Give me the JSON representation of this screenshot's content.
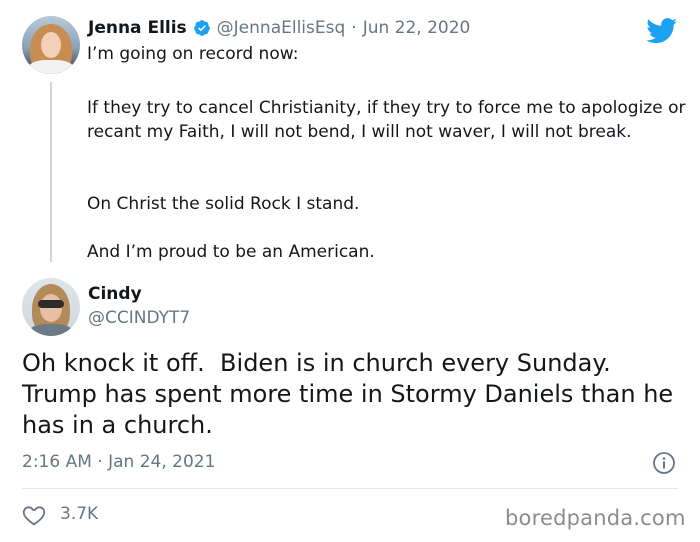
{
  "original_tweet": {
    "author_name": "Jenna Ellis",
    "handle": "@JennaEllisEsq",
    "separator": "·",
    "date": "Jun 22, 2020",
    "paragraphs": [
      "I’m going on record now:",
      "If they try to cancel Christianity, if they try to force me to apologize or recant my Faith, I will not bend, I will not waver, I will not break.",
      "On Christ the solid Rock I stand.",
      "And I’m proud to be an American."
    ]
  },
  "reply_tweet": {
    "author_name": "Cindy",
    "handle": "@CCINDYT7",
    "text": "Oh knock it off.  Biden is in church every Sunday. Trump has spent more time in Stormy Daniels than he has in a church.",
    "timestamp": "2:16 AM · Jan 24, 2021",
    "like_count": "3.7K"
  },
  "watermark": "boredpanda.com",
  "colors": {
    "twitter_blue": "#1da1f2",
    "secondary_text": "#657786",
    "primary_text": "#14171a"
  },
  "icons": {
    "verified": "verified-badge-icon",
    "logo": "twitter-bird-icon",
    "info": "info-icon",
    "like": "heart-icon"
  }
}
